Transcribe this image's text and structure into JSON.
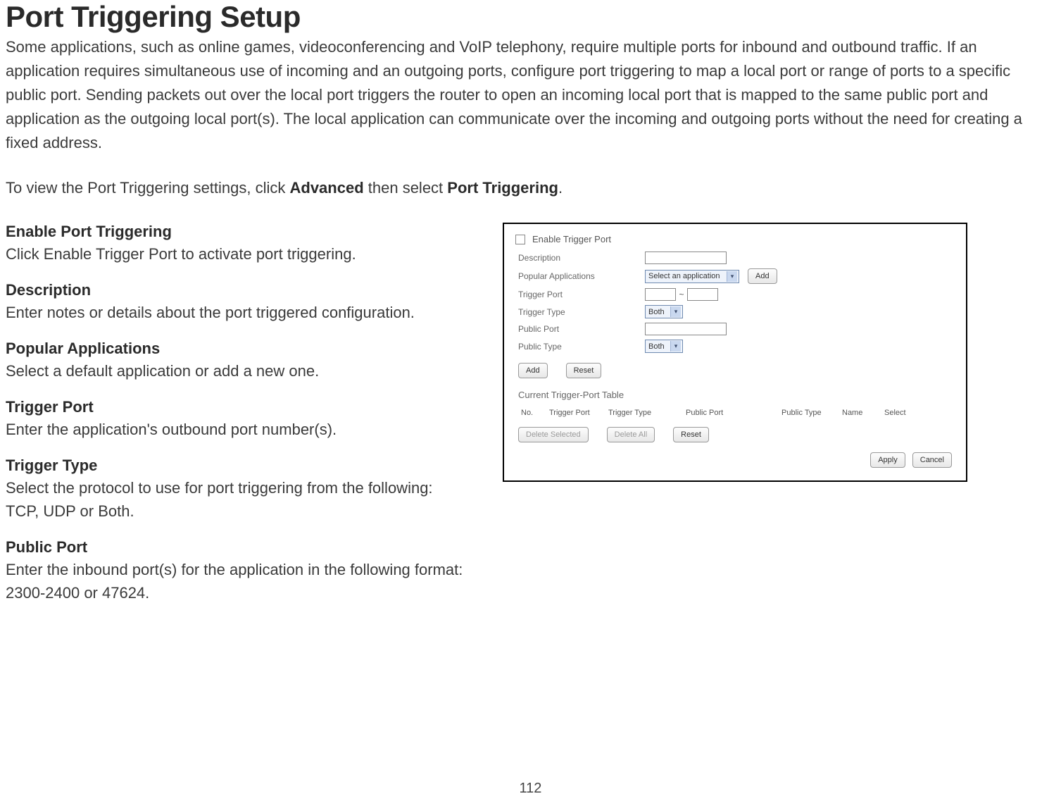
{
  "page_number": "112",
  "title": "Port Triggering Setup",
  "intro": "Some applications, such as online games, videoconferencing and VoIP telephony, require multiple ports for inbound and outbound traffic. If an application requires simultaneous use of incoming and an outgoing ports, configure port triggering to map a local port or range of ports to a specific public port. Sending packets out over the local port triggers the router to open an incoming local port that is mapped to the same public port and application as the outgoing local port(s). The local application can communicate over the incoming and outgoing ports without the need for creating a fixed address.",
  "nav_instruction": {
    "prefix": "To view the Port Triggering settings, click ",
    "bold1": "Advanced",
    "middle": " then select ",
    "bold2": "Port Triggering",
    "suffix": "."
  },
  "defs": [
    {
      "title": "Enable Port Triggering",
      "text": "Click Enable Trigger Port to activate port triggering."
    },
    {
      "title": "Description",
      "text": "Enter notes or details about the port triggered configuration."
    },
    {
      "title": "Popular Applications",
      "text": "Select a default application or add a new one."
    },
    {
      "title": "Trigger Port",
      "text": "Enter the application's outbound port number(s)."
    },
    {
      "title": "Trigger Type",
      "text": "Select the protocol to use for port triggering from the following: TCP, UDP or Both."
    },
    {
      "title": "Public Port",
      "text": "Enter the inbound port(s) for the application in the following format: 2300-2400 or 47624."
    }
  ],
  "panel": {
    "enable_label": "Enable Trigger Port",
    "enable_checked": false,
    "fields": {
      "description_label": "Description",
      "popular_apps_label": "Popular Applications",
      "popular_apps_selected": "Select an application",
      "popular_apps_add": "Add",
      "trigger_port_label": "Trigger Port",
      "trigger_port_from": "",
      "trigger_port_sep": "~",
      "trigger_port_to": "",
      "trigger_type_label": "Trigger Type",
      "trigger_type_selected": "Both",
      "public_port_label": "Public Port",
      "public_port_value": "",
      "public_type_label": "Public Type",
      "public_type_selected": "Both"
    },
    "buttons": {
      "add": "Add",
      "reset": "Reset",
      "delete_selected": "Delete Selected",
      "delete_all": "Delete All",
      "reset2": "Reset",
      "apply": "Apply",
      "cancel": "Cancel"
    },
    "table": {
      "heading": "Current Trigger-Port Table",
      "columns": {
        "no": "No.",
        "trigger_port": "Trigger Port",
        "trigger_type": "Trigger Type",
        "public_port": "Public Port",
        "public_type": "Public Type",
        "name": "Name",
        "select": "Select"
      }
    }
  }
}
